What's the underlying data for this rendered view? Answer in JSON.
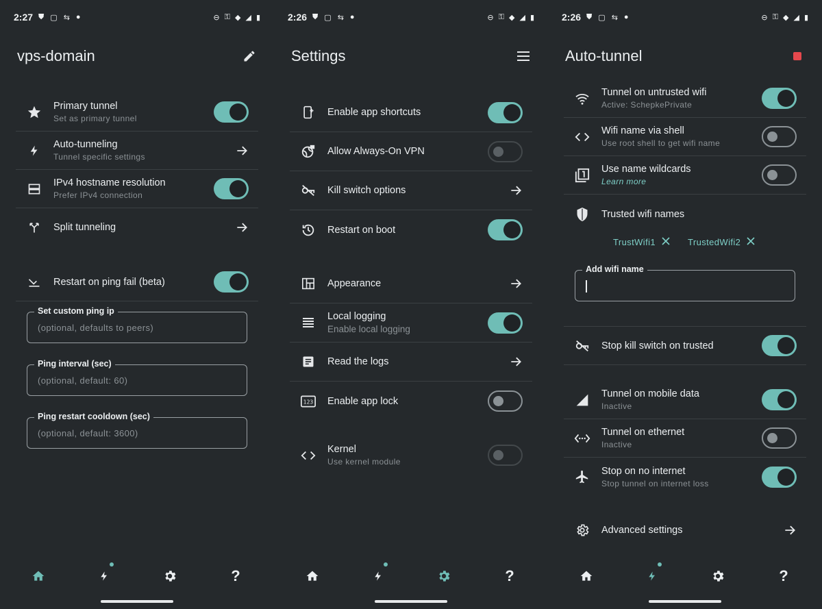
{
  "screens": [
    {
      "time": "2:27",
      "title": "vps-domain",
      "action_icon": "pencil-icon",
      "rows": [
        {
          "icon": "star-icon",
          "label": "Primary tunnel",
          "sub": "Set as primary tunnel",
          "control": "toggle",
          "state": "on"
        },
        {
          "icon": "bolt-icon",
          "label": "Auto-tunneling",
          "sub": "Tunnel specific settings",
          "control": "arrow"
        },
        {
          "icon": "server-icon",
          "label": "IPv4 hostname resolution",
          "sub": "Prefer IPv4 connection",
          "control": "toggle",
          "state": "on"
        },
        {
          "icon": "split-icon",
          "label": "Split tunneling",
          "sub": "",
          "control": "arrow"
        },
        {
          "icon": "ping-fail-icon",
          "label": "Restart on ping fail (beta)",
          "sub": "",
          "control": "toggle",
          "state": "on"
        }
      ],
      "fields": [
        {
          "label": "Set custom ping ip",
          "value": "(optional, defaults to peers)"
        },
        {
          "label": "Ping interval (sec)",
          "value": "(optional, default:  60)"
        },
        {
          "label": "Ping restart cooldown (sec)",
          "value": "(optional, default:  3600)"
        }
      ],
      "nav_active": "home"
    },
    {
      "time": "2:26",
      "title": "Settings",
      "action_icon": "menu-icon",
      "rows": [
        {
          "icon": "shortcut-icon",
          "label": "Enable app shortcuts",
          "sub": "",
          "control": "toggle",
          "state": "on"
        },
        {
          "icon": "vpn-globe-icon",
          "label": "Allow Always-On VPN",
          "sub": "",
          "control": "toggle",
          "state": "disabled"
        },
        {
          "icon": "key-off-icon",
          "label": "Kill switch options",
          "sub": "",
          "control": "arrow"
        },
        {
          "icon": "history-icon",
          "label": "Restart on boot",
          "sub": "",
          "control": "toggle",
          "state": "on"
        },
        {
          "icon": "layout-icon",
          "label": "Appearance",
          "sub": "",
          "control": "arrow"
        },
        {
          "icon": "list-icon",
          "label": "Local logging",
          "sub": "Enable local logging",
          "control": "toggle",
          "state": "on"
        },
        {
          "icon": "logs-icon",
          "label": "Read the logs",
          "sub": "",
          "control": "arrow"
        },
        {
          "icon": "pin-icon",
          "label": "Enable app lock",
          "sub": "",
          "control": "toggle",
          "state": "off"
        },
        {
          "icon": "code-icon",
          "label": "Kernel",
          "sub": "Use kernel module",
          "control": "toggle",
          "state": "disabled"
        }
      ],
      "nav_active": "settings"
    },
    {
      "time": "2:26",
      "title": "Auto-tunnel",
      "action_icon": "stop-icon",
      "rows": [
        {
          "icon": "wifi-icon",
          "label": "Tunnel on untrusted wifi",
          "sub": "Active: SchepkePrivate",
          "control": "toggle",
          "state": "on"
        },
        {
          "icon": "code-icon",
          "label": "Wifi name via shell",
          "sub": "Use root shell to get wifi name",
          "control": "toggle",
          "state": "off"
        },
        {
          "icon": "filter-1-icon",
          "label": "Use name wildcards",
          "sub": "Learn more",
          "control": "toggle",
          "state": "off"
        },
        {
          "icon": "shield-icon",
          "label": "Trusted wifi names",
          "sub": "",
          "control": "none"
        },
        {
          "icon": "key-off-icon",
          "label": "Stop kill switch on trusted",
          "sub": "",
          "control": "toggle",
          "state": "on"
        },
        {
          "icon": "signal-icon",
          "label": "Tunnel on mobile data",
          "sub": "Inactive",
          "control": "toggle",
          "state": "on"
        },
        {
          "icon": "ethernet-icon",
          "label": "Tunnel on ethernet",
          "sub": "Inactive",
          "control": "toggle",
          "state": "off"
        },
        {
          "icon": "airplane-icon",
          "label": "Stop on no internet",
          "sub": "Stop tunnel on internet loss",
          "control": "toggle",
          "state": "on"
        },
        {
          "icon": "gear-icon",
          "label": "Advanced settings",
          "sub": "",
          "control": "arrow"
        }
      ],
      "chips": [
        "TrustWifi1",
        "TrustedWifi2"
      ],
      "add_field": {
        "label": "Add wifi name",
        "value": ""
      },
      "nav_active": "autotunnel"
    }
  ],
  "nav": {
    "help_label": "?"
  },
  "colors": {
    "accent": "#6fbdb6",
    "background": "#25292c",
    "stop": "#e5484d"
  }
}
